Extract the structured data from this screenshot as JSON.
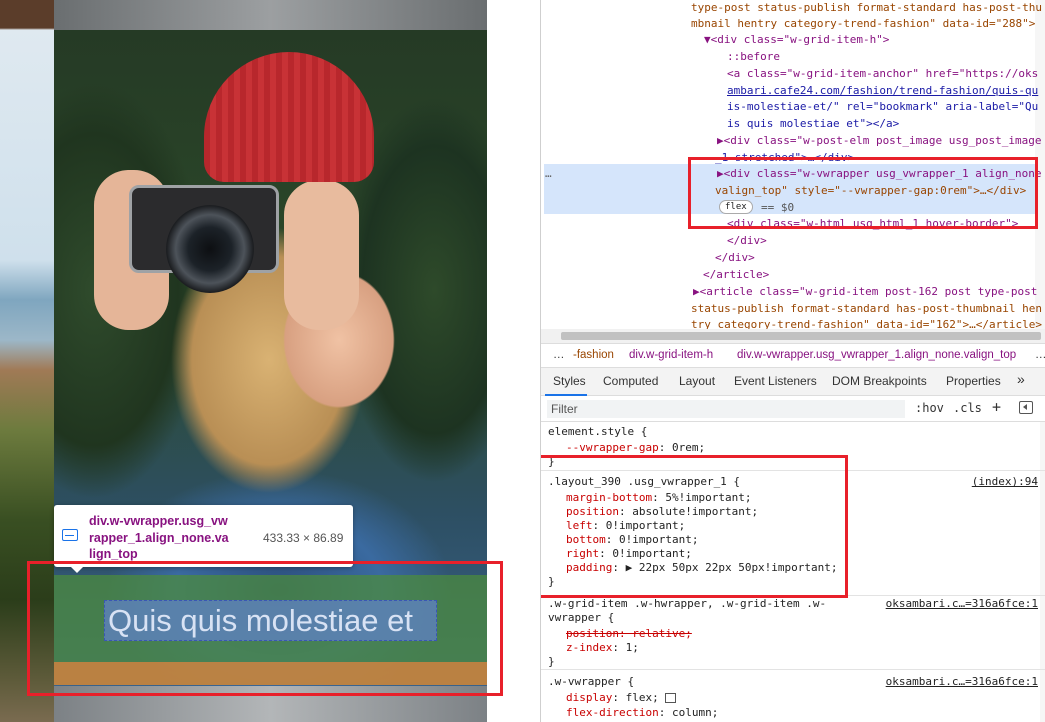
{
  "webpage": {
    "post_title": "Quis quis molestiae et",
    "tooltip": {
      "selector": "div.w-vwrapper.usg_vwrapper_1.align_none.valign_top",
      "size": "433.33 × 86.89"
    }
  },
  "elements": {
    "lines": [
      {
        "t": "type-post status-publish format-standard has-post-thu"
      },
      {
        "t": "mbnail hentry category-trend-fashion\" data-id=\"288\">"
      },
      {
        "t": "▼<div class=\"w-grid-item-h\">"
      },
      {
        "t": "::before"
      },
      {
        "t": "<a class=\"w-grid-item-anchor\" href=\"https://oks"
      },
      {
        "t": "ambari.cafe24.com/fashion/trend-fashion/quis-qu"
      },
      {
        "t": "is-molestiae-et/\" rel=\"bookmark\" aria-label=\"Qu"
      },
      {
        "t": "is quis molestiae et\"></a>"
      },
      {
        "t": "▶<div class=\"w-post-elm post_image usg_post_image"
      },
      {
        "t": "_1 stretched\">…</div>"
      },
      {
        "t": "▶<div class=\"w-vwrapper usg_vwrapper_1 align_none"
      },
      {
        "t": "valign_top\" style=\"--vwrapper-gap:0rem\">…</div>"
      },
      {
        "t": "== $0"
      },
      {
        "t": "<div class=\"w-html usg_html_1 hover-border\">"
      },
      {
        "t": "</div>"
      },
      {
        "t": "</div>"
      },
      {
        "t": "</article>"
      },
      {
        "t": "▶<article class=\"w-grid-item post-162 post type-post"
      },
      {
        "t": "status-publish format-standard has-post-thumbnail hen"
      },
      {
        "t": "try category-trend-fashion\" data-id=\"162\">…</article>"
      }
    ],
    "flex_badge": "flex",
    "ellipsis": "…"
  },
  "breadcrumb": [
    "…",
    "-fashion",
    "div.w-grid-item-h",
    "div.w-vwrapper.usg_vwrapper_1.align_none.valign_top",
    "…"
  ],
  "tabs": [
    "Styles",
    "Computed",
    "Layout",
    "Event Listeners",
    "DOM Breakpoints",
    "Properties",
    "»"
  ],
  "filter": {
    "placeholder": "Filter",
    "hov": ":hov",
    "cls": ".cls",
    "plus": "+"
  },
  "styles": {
    "r1_sel": "element.style {",
    "r1_p1": "--vwrapper-gap",
    "r1_v1": "0rem;",
    "r1_close": "}",
    "r2_sel": ".layout_390 .usg_vwrapper_1 {",
    "r2_src": "(index):94",
    "r2_p1": "margin-bottom",
    "r2_v1": "5%!important;",
    "r2_p2": "position",
    "r2_v2": "absolute!important;",
    "r2_p3": "left",
    "r2_v3": "0!important;",
    "r2_p4": "bottom",
    "r2_v4": "0!important;",
    "r2_p5": "right",
    "r2_v5": "0!important;",
    "r2_p6": "padding",
    "r2_v6": "▶ 22px 50px 22px 50px!important;",
    "r2_close": "}",
    "r3_sel1": ".w-grid-item .w-hwrapper, .w-grid-item .w-",
    "r3_sel2": "vwrapper {",
    "r3_src": "oksambari.c…=316a6fce:1",
    "r3_p1": "position: relative;",
    "r3_p2": "z-index",
    "r3_v2": "1;",
    "r3_close": "}",
    "r4_sel": ".w-vwrapper {",
    "r4_src": "oksambari.c…=316a6fce:1",
    "r4_p1": "display",
    "r4_v1": "flex;",
    "r4_p2": "flex-direction",
    "r4_v2": "column;"
  },
  "colors": {
    "highlight_red": "#e8202a",
    "selected_row": "#d5e5fb",
    "tag_purple": "#881280"
  }
}
